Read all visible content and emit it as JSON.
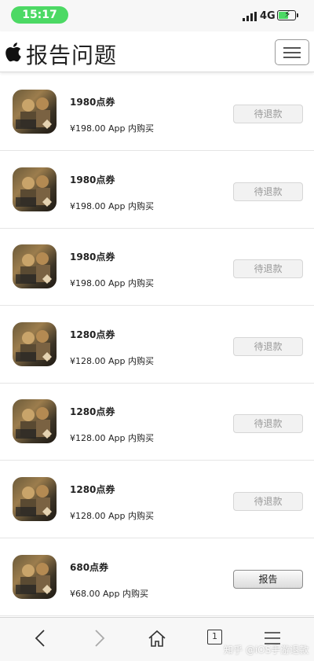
{
  "status_bar": {
    "time": "15:17",
    "network": "4G"
  },
  "header": {
    "title": "报告问题"
  },
  "items": [
    {
      "name": "1980点券",
      "price": "¥198.00 App 内购买",
      "action": "待退款",
      "action_state": "pending"
    },
    {
      "name": "1980点券",
      "price": "¥198.00 App 内购买",
      "action": "待退款",
      "action_state": "pending"
    },
    {
      "name": "1980点券",
      "price": "¥198.00 App 内购买",
      "action": "待退款",
      "action_state": "pending"
    },
    {
      "name": "1280点券",
      "price": "¥128.00 App 内购买",
      "action": "待退款",
      "action_state": "pending"
    },
    {
      "name": "1280点券",
      "price": "¥128.00 App 内购买",
      "action": "待退款",
      "action_state": "pending"
    },
    {
      "name": "1280点券",
      "price": "¥128.00 App 内购买",
      "action": "待退款",
      "action_state": "pending"
    },
    {
      "name": "680点券",
      "price": "¥68.00 App 内购买",
      "action": "报告",
      "action_state": "report"
    }
  ],
  "toolbar": {
    "tab_count": "1",
    "icons": [
      "back-icon",
      "forward-icon",
      "home-icon",
      "tabs-icon",
      "menu-icon"
    ]
  },
  "watermark": "知乎 @iOS手游退款",
  "colors": {
    "status_pill": "#4cd964",
    "battery_fill": "#4cd964"
  }
}
